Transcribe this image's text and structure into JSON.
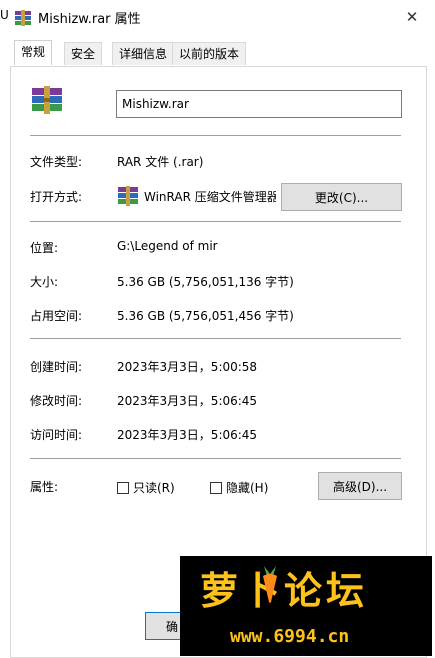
{
  "window": {
    "edge_glyph": "U",
    "title": "Mishizw.rar 属性",
    "close_glyph": "✕"
  },
  "tabs": [
    {
      "label": "常规",
      "active": true
    },
    {
      "label": "安全",
      "active": false
    },
    {
      "label": "详细信息",
      "active": false
    },
    {
      "label": "以前的版本",
      "active": false
    }
  ],
  "file": {
    "name": "Mishizw.rar"
  },
  "props": {
    "type_label": "文件类型:",
    "type_value": "RAR 文件 (.rar)",
    "open_label": "打开方式:",
    "open_value": "WinRAR 压缩文件管理器",
    "change_button": "更改(C)...",
    "location_label": "位置:",
    "location_value": "G:\\Legend of mir",
    "size_label": "大小:",
    "size_value": "5.36 GB (5,756,051,136 字节)",
    "disk_label": "占用空间:",
    "disk_value": "5.36 GB (5,756,051,456 字节)",
    "created_label": "创建时间:",
    "created_value": "2023年3月3日，5:00:58",
    "modified_label": "修改时间:",
    "modified_value": "2023年3月3日，5:06:45",
    "accessed_label": "访问时间:",
    "accessed_value": "2023年3月3日，5:06:45"
  },
  "attributes": {
    "label": "属性:",
    "readonly": "只读(R)",
    "hidden": "隐藏(H)",
    "advanced_button": "高级(D)..."
  },
  "footer": {
    "ok_button_partial": "确"
  },
  "watermark": {
    "title": "萝卜论坛",
    "url": "www.6994.cn"
  },
  "colors": {
    "watermark_gold": "#ffc21a",
    "accent": "#0078d7"
  }
}
